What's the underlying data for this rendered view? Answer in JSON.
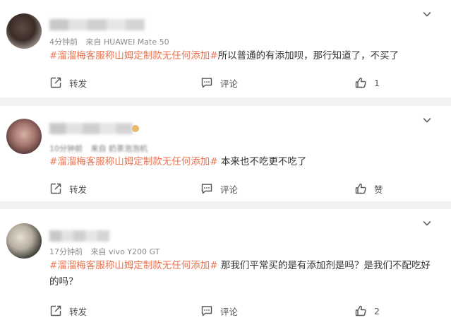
{
  "comments": [
    {
      "time": "4分钟前",
      "source": "来自 HUAWEI Mate 50",
      "topic": "#溜溜梅客服称山姆定制款无任何添加#",
      "text": "所以普通的有添加呗，那行知道了，不买了",
      "repost_label": "转发",
      "comment_label": "评论",
      "like_label": "1"
    },
    {
      "time": "10分钟前",
      "source": "来自 奶茶泡泡机",
      "topic": "#溜溜梅客服称山姆定制款无任何添加#",
      "text": " 本来也不吃更不吃了",
      "repost_label": "转发",
      "comment_label": "评论",
      "like_label": "赞"
    },
    {
      "time": "17分钟前",
      "source": "来自 vivo Y200 GT",
      "topic": "#溜溜梅客服称山姆定制款无任何添加#",
      "text": " 那我们平常买的是有添加剂是吗？是我们不配吃好的吗？",
      "repost_label": "转发",
      "comment_label": "评论",
      "like_label": "2"
    }
  ],
  "icons": {
    "repost": "repost-icon",
    "comment": "comment-icon",
    "like": "like-icon",
    "menu": "chevron-down-icon"
  },
  "colors": {
    "topic": "#eb7350",
    "meta": "#8a8a8a",
    "background": "#f2f2f2"
  }
}
